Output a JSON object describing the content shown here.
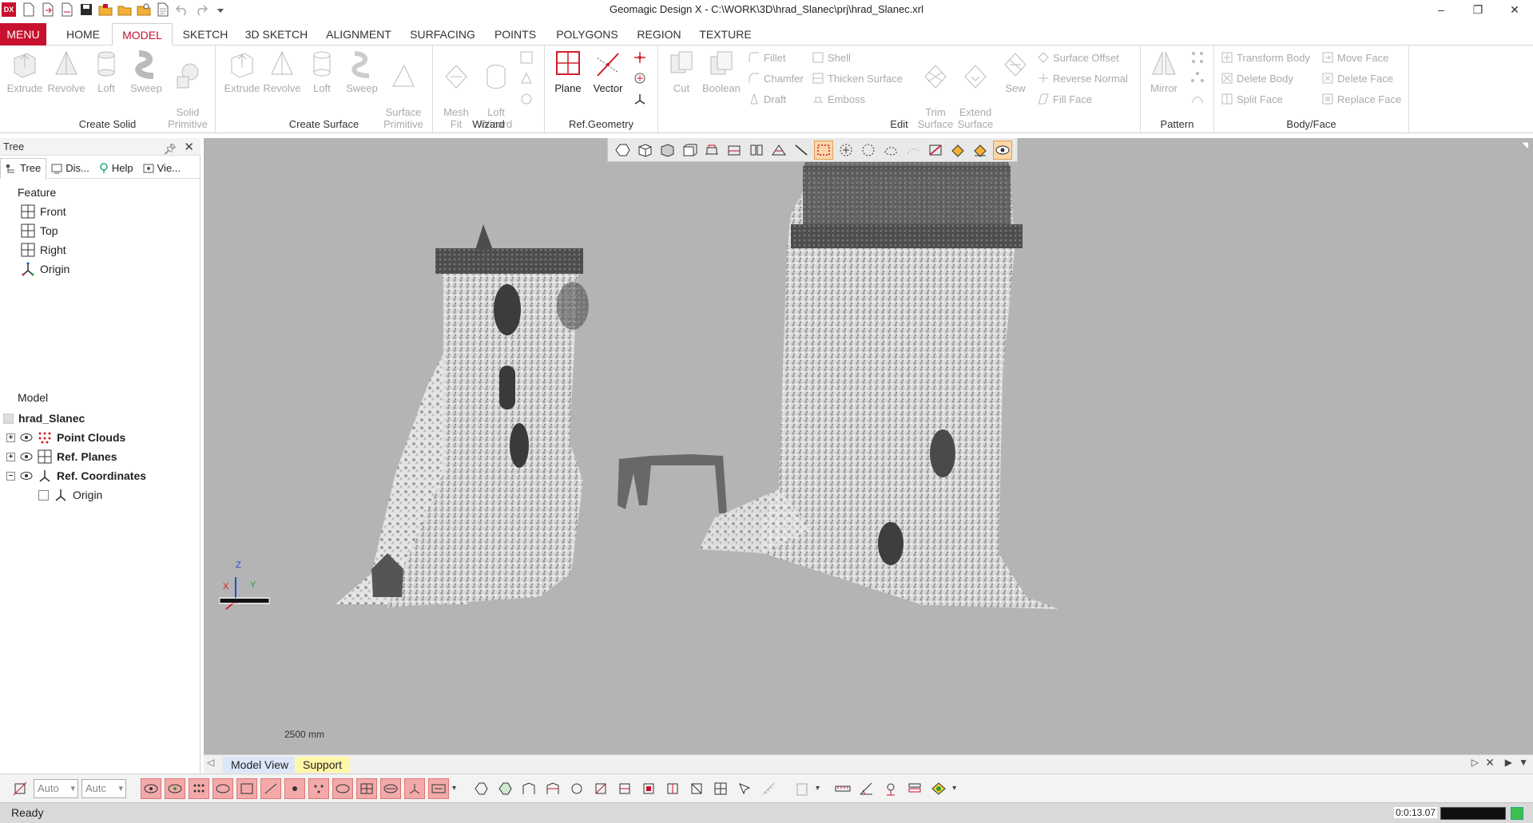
{
  "app": {
    "logo_text": "DX",
    "title": "Geomagic Design X - C:\\WORK\\3D\\hrad_Slanec\\prj\\hrad_Slanec.xrl"
  },
  "window_controls": {
    "minimize": "–",
    "restore": "❐",
    "close": "✕"
  },
  "tabs": [
    {
      "label": "MENU"
    },
    {
      "label": "HOME"
    },
    {
      "label": "MODEL"
    },
    {
      "label": "SKETCH"
    },
    {
      "label": "3D SKETCH"
    },
    {
      "label": "ALIGNMENT"
    },
    {
      "label": "SURFACING"
    },
    {
      "label": "POINTS"
    },
    {
      "label": "POLYGONS"
    },
    {
      "label": "REGION"
    },
    {
      "label": "TEXTURE"
    }
  ],
  "active_tab": "MODEL",
  "ribbon": {
    "create_solid": {
      "label": "Create Solid",
      "buttons": [
        {
          "label": "Extrude"
        },
        {
          "label": "Revolve"
        },
        {
          "label": "Loft"
        },
        {
          "label": "Sweep"
        },
        {
          "label": "Solid\nPrimitive"
        }
      ]
    },
    "create_surface": {
      "label": "Create Surface",
      "buttons": [
        {
          "label": "Extrude"
        },
        {
          "label": "Revolve"
        },
        {
          "label": "Loft"
        },
        {
          "label": "Sweep"
        },
        {
          "label": "Surface\nPrimitive"
        }
      ]
    },
    "wizard": {
      "label": "Wizard",
      "buttons": [
        {
          "label": "Mesh\nFit"
        },
        {
          "label": "Loft\nWizard"
        }
      ]
    },
    "ref_geometry": {
      "label": "Ref.Geometry",
      "buttons": [
        {
          "label": "Plane"
        },
        {
          "label": "Vector"
        }
      ]
    },
    "edit": {
      "label": "Edit",
      "big_buttons": [
        {
          "label": "Cut"
        },
        {
          "label": "Boolean"
        }
      ],
      "small_col1": [
        {
          "label": "Fillet"
        },
        {
          "label": "Chamfer"
        },
        {
          "label": "Draft"
        }
      ],
      "small_col2": [
        {
          "label": "Shell"
        },
        {
          "label": "Thicken Surface"
        },
        {
          "label": "Emboss"
        }
      ],
      "big_buttons2": [
        {
          "label": "Trim\nSurface"
        },
        {
          "label": "Extend\nSurface"
        },
        {
          "label": "Sew"
        }
      ],
      "small_col3": [
        {
          "label": "Surface Offset"
        },
        {
          "label": "Reverse Normal"
        },
        {
          "label": "Fill Face"
        }
      ]
    },
    "pattern": {
      "label": "Pattern",
      "buttons": [
        {
          "label": "Mirror"
        }
      ]
    },
    "body_face": {
      "label": "Body/Face",
      "small_col1": [
        {
          "label": "Transform Body"
        },
        {
          "label": "Delete Body"
        },
        {
          "label": "Split Face"
        }
      ],
      "small_col2": [
        {
          "label": "Move Face"
        },
        {
          "label": "Delete Face"
        },
        {
          "label": "Replace Face"
        }
      ]
    }
  },
  "panel": {
    "title": "Tree",
    "tabs": [
      {
        "label": "Tree"
      },
      {
        "label": "Dis..."
      },
      {
        "label": "Help"
      },
      {
        "label": "Vie..."
      }
    ],
    "feature_label": "Feature",
    "features": [
      {
        "label": "Front"
      },
      {
        "label": "Top"
      },
      {
        "label": "Right"
      },
      {
        "label": "Origin"
      }
    ],
    "model_label": "Model",
    "model_root": "hrad_Slanec",
    "model_items": [
      {
        "label": "Point Clouds"
      },
      {
        "label": "Ref. Planes"
      },
      {
        "label": "Ref. Coordinates"
      }
    ],
    "model_sub_item": "Origin"
  },
  "viewport": {
    "scale_label": "2500 mm",
    "triad": {
      "x": "X",
      "y": "Y",
      "z": "Z"
    }
  },
  "view_tabs": [
    {
      "label": "Model View"
    },
    {
      "label": "Support"
    }
  ],
  "bottom": {
    "select1": "Auto",
    "select2": "Autc"
  },
  "status": {
    "text": "Ready",
    "time": "0:0:13.07"
  },
  "colors": {
    "accent": "#c8102e",
    "viewport_bg": "#b4b4b4",
    "status_green": "#3cbf4d"
  }
}
